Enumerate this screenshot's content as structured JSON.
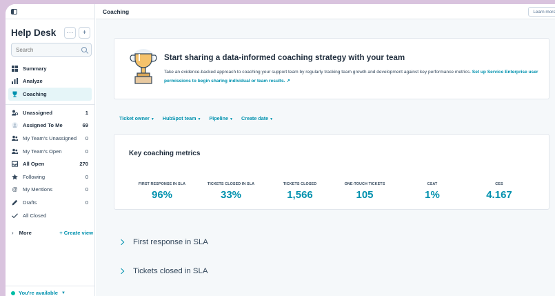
{
  "sidebar": {
    "title": "Help Desk",
    "more_btn": "···",
    "add_btn": "+",
    "search_placeholder": "Search",
    "primary": [
      {
        "label": "Summary",
        "icon": "summary-icon"
      },
      {
        "label": "Analyze",
        "icon": "bar-chart-icon"
      },
      {
        "label": "Coaching",
        "icon": "trophy-icon",
        "active": true
      }
    ],
    "views": [
      {
        "label": "Unassigned",
        "count": "1",
        "bold": true,
        "icon": "unassigned-icon"
      },
      {
        "label": "Assigned To Me",
        "count": "69",
        "bold": true,
        "icon": "avatar-icon"
      },
      {
        "label": "My Team's Unassigned",
        "count": "0",
        "bold": false,
        "icon": "team-icon"
      },
      {
        "label": "My Team's Open",
        "count": "0",
        "bold": false,
        "icon": "team-icon"
      },
      {
        "label": "All Open",
        "count": "270",
        "bold": true,
        "icon": "inbox-icon"
      },
      {
        "label": "Following",
        "count": "0",
        "bold": false,
        "icon": "star-icon"
      },
      {
        "label": "My Mentions",
        "count": "0",
        "bold": false,
        "icon": "at-icon"
      },
      {
        "label": "Drafts",
        "count": "0",
        "bold": false,
        "icon": "pencil-icon"
      },
      {
        "label": "All Closed",
        "count": "",
        "bold": false,
        "icon": "check-icon"
      }
    ],
    "more_label": "More",
    "create_view": "+ Create view",
    "availability": "You're available"
  },
  "header": {
    "title": "Coaching",
    "learn_more": "Learn more"
  },
  "banner": {
    "heading": "Start sharing a data-informed coaching strategy with your team",
    "body": "Take an evidence-backed approach to coaching your support team by regularly tracking team growth and development against key performance metrics. ",
    "link": "Set up Service Enterprise user permissions to begin sharing individual or team results. ↗"
  },
  "filters": [
    "Ticket owner",
    "HubSpot team",
    "Pipeline",
    "Create date"
  ],
  "metrics": {
    "title": "Key coaching metrics",
    "items": [
      {
        "label": "FIRST RESPONSE IN SLA",
        "value": "96%"
      },
      {
        "label": "TICKETS CLOSED IN SLA",
        "value": "33%"
      },
      {
        "label": "TICKETS CLOSED",
        "value": "1,566"
      },
      {
        "label": "ONE-TOUCH TICKETS",
        "value": "105"
      },
      {
        "label": "CSAT",
        "value": "1%"
      },
      {
        "label": "CES",
        "value": "4.167"
      }
    ]
  },
  "sections": [
    "First response in SLA",
    "Tickets closed in SLA"
  ],
  "colors": {
    "accent": "#0091ae",
    "active_bg": "#e5f5f8",
    "page_bg": "#d9c3de"
  }
}
